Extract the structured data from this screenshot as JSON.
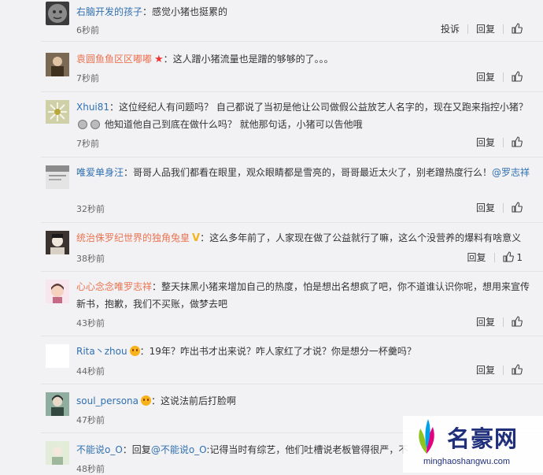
{
  "comments": [
    {
      "user": "右脑开发的孩子",
      "badge": "",
      "text": "：感觉小猪也挺累的",
      "mention": "",
      "time": "6秒前",
      "report": "投诉",
      "reply": "回复",
      "likes": ""
    },
    {
      "user": "袁圆鱼鱼区区嘟嘟",
      "badge": "★",
      "text": "：这人蹭小猪流量也是蹭的够够的了。。。",
      "mention": "",
      "time": "7秒前",
      "report": "",
      "reply": "回复",
      "likes": ""
    },
    {
      "user": "Xhui81",
      "badge": "",
      "text": "：这位经纪人有问题吗？ 自己都说了当初是他让公司做假公益放艺人名字的，现在又跑来指控小猪？",
      "text2": " 他知道他自己到底在做什么吗？ 就他那句话，小猪可以告他哦",
      "mention": "",
      "time": "7秒前",
      "report": "",
      "reply": "回复",
      "likes": ""
    },
    {
      "user": "唯爱单身汪",
      "badge": "",
      "text": "：哥哥人品我们都看在眼里，观众眼睛都是雪亮的，哥哥最近太火了，别老蹭热度行么！",
      "mention": "@罗志祥",
      "time": "32秒前",
      "report": "",
      "reply": "回复",
      "likes": ""
    },
    {
      "user": "统治侏罗纪世界的独角兔皇",
      "badge": "V",
      "text": "：这么多年前了，人家现在做了公益就行了嘛，这么个没营养的爆料有啥意义",
      "mention": "",
      "time": "38秒前",
      "report": "",
      "reply": "回复",
      "likes": "1"
    },
    {
      "user": "心心念念唯罗志祥",
      "badge": "",
      "text": "：整天抹黑小猪来增加自己的热度，怕是想出名想疯了吧，你不道谁认识你呢，想用来宣传新书，抱歉，我们不买账，做梦去吧",
      "mention": "",
      "time": "43秒前",
      "report": "",
      "reply": "回复",
      "likes": ""
    },
    {
      "user": "Rita丶zhou",
      "badge": "face",
      "text": "：19年？咋出书才出来说？咋人家红了才说？你是想分一杯羹吗？",
      "mention": "",
      "time": "44秒前",
      "report": "",
      "reply": "回复",
      "likes": ""
    },
    {
      "user": "soul_persona",
      "badge": "face",
      "text": "：这说法前后打脸啊",
      "mention": "",
      "time": "47秒前",
      "report": "",
      "reply": "回复",
      "likes": ""
    },
    {
      "user": "不能说o_O",
      "badge": "",
      "text": "：回复",
      "mention": "@不能说o_O",
      "text_after": ":记得当时有综艺，他们吐槽说老板管得很严，不",
      "time": "48秒前",
      "report": "",
      "reply": "",
      "likes": ""
    }
  ],
  "watermark": {
    "brand": "名豪网",
    "url": "minghaoshangwu.com"
  }
}
